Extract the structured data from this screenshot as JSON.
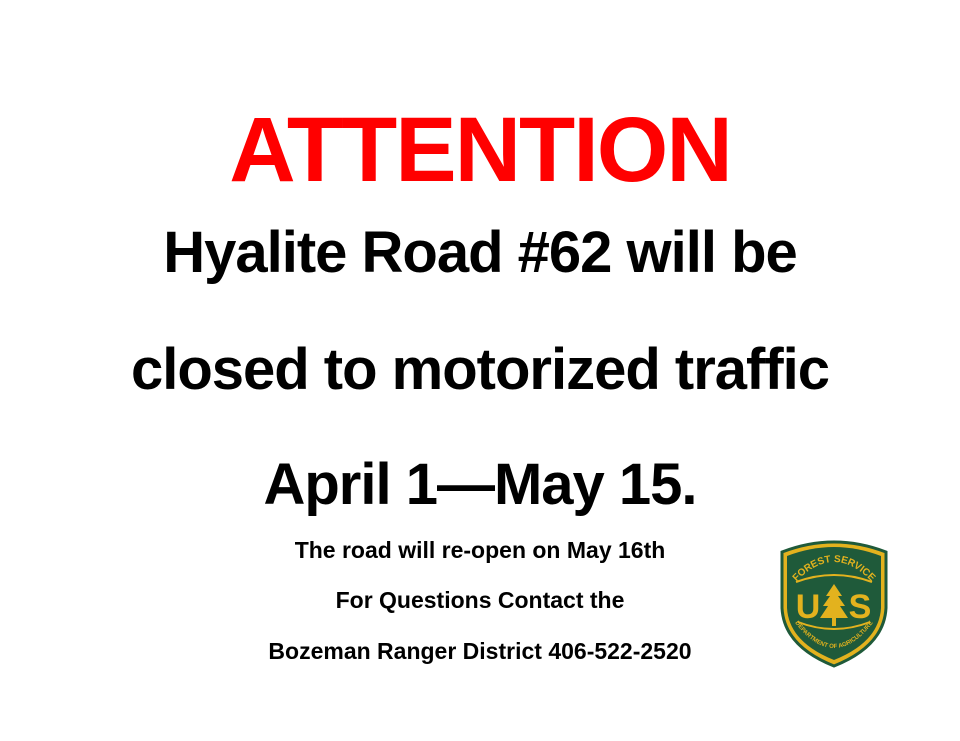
{
  "colors": {
    "attention": "#ff0000",
    "text": "#000000",
    "background": "#ffffff",
    "shield_green": "#1f5a3a",
    "shield_gold": "#e3b21e"
  },
  "sign": {
    "heading": "ATTENTION",
    "line1": "Hyalite Road #62 will be",
    "line2": "closed to motorized traffic",
    "line3": "April 1—May 15.",
    "reopen": "The road will re-open on May 16th",
    "contact_intro": "For Questions Contact the",
    "contact": "Bozeman Ranger District 406-522-2520"
  },
  "logo": {
    "top_text": "FOREST SERVICE",
    "bottom_text": "DEPARTMENT OF AGRICULTURE",
    "left_letter": "U",
    "right_letter": "S",
    "icon": "pine-tree"
  }
}
